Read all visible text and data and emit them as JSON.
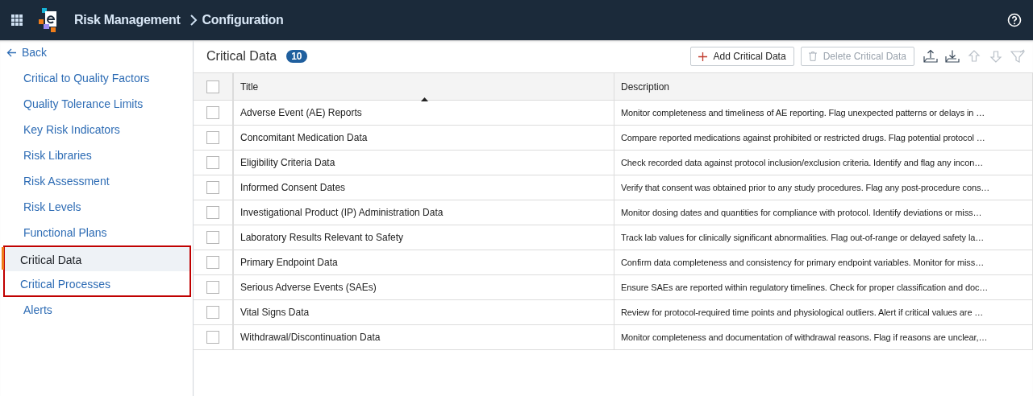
{
  "header": {
    "app_title": "Risk Management",
    "breadcrumb": "Configuration"
  },
  "sidebar": {
    "back": "Back",
    "items": [
      {
        "label": "Critical to Quality Factors",
        "selected": false,
        "highlighted": false
      },
      {
        "label": "Quality Tolerance Limits",
        "selected": false,
        "highlighted": false
      },
      {
        "label": "Key Risk Indicators",
        "selected": false,
        "highlighted": false
      },
      {
        "label": "Risk Libraries",
        "selected": false,
        "highlighted": false
      },
      {
        "label": "Risk Assessment",
        "selected": false,
        "highlighted": false
      },
      {
        "label": "Risk Levels",
        "selected": false,
        "highlighted": false
      },
      {
        "label": "Functional Plans",
        "selected": false,
        "highlighted": false
      },
      {
        "label": "Critical Data",
        "selected": true,
        "highlighted": true
      },
      {
        "label": "Critical Processes",
        "selected": false,
        "highlighted": true
      },
      {
        "label": "Alerts",
        "selected": false,
        "highlighted": false
      }
    ]
  },
  "page": {
    "title": "Critical Data",
    "count": "10"
  },
  "toolbar": [
    {
      "kind": "add",
      "label": "Add Critical Data",
      "disabled": false
    },
    {
      "kind": "delete",
      "label": "Delete Critical Data",
      "disabled": true
    },
    {
      "kind": "upload",
      "disabled": false
    },
    {
      "kind": "download",
      "disabled": false
    },
    {
      "kind": "up",
      "disabled": true
    },
    {
      "kind": "down",
      "disabled": true
    },
    {
      "kind": "filter",
      "disabled": true
    }
  ],
  "table": {
    "header_checked": false,
    "columns": [
      "Title",
      "Description"
    ],
    "rows": [
      {
        "checked": false,
        "title": "Adverse Event (AE) Reports",
        "description": "Monitor completeness and timeliness of AE reporting. Flag unexpected patterns or delays in …"
      },
      {
        "checked": false,
        "title": "Concomitant Medication Data",
        "description": "Compare reported medications against prohibited or restricted drugs. Flag potential protocol …"
      },
      {
        "checked": false,
        "title": "Eligibility Criteria Data",
        "description": "Check recorded data against protocol inclusion/exclusion criteria. Identify and flag any incon…"
      },
      {
        "checked": false,
        "title": "Informed Consent Dates",
        "description": "Verify that consent was obtained prior to any study procedures. Flag any post-procedure cons…"
      },
      {
        "checked": false,
        "title": "Investigational Product (IP) Administration Data",
        "description": "Monitor dosing dates and quantities for compliance with protocol. Identify deviations or miss…"
      },
      {
        "checked": false,
        "title": "Laboratory Results Relevant to Safety",
        "description": "Track lab values for clinically significant abnormalities. Flag out-of-range or delayed safety la…"
      },
      {
        "checked": false,
        "title": "Primary Endpoint Data",
        "description": "Confirm data completeness and consistency for primary endpoint variables. Monitor for miss…"
      },
      {
        "checked": false,
        "title": "Serious Adverse Events (SAEs)",
        "description": "Ensure SAEs are reported within regulatory timelines. Check for proper classification and doc…"
      },
      {
        "checked": false,
        "title": "Vital Signs Data",
        "description": "Review for protocol-required time points and physiological outliers. Alert if critical values are …"
      },
      {
        "checked": false,
        "title": "Withdrawal/Discontinuation Data",
        "description": "Monitor completeness and documentation of withdrawal reasons. Flag if reasons are unclear,…"
      }
    ]
  }
}
